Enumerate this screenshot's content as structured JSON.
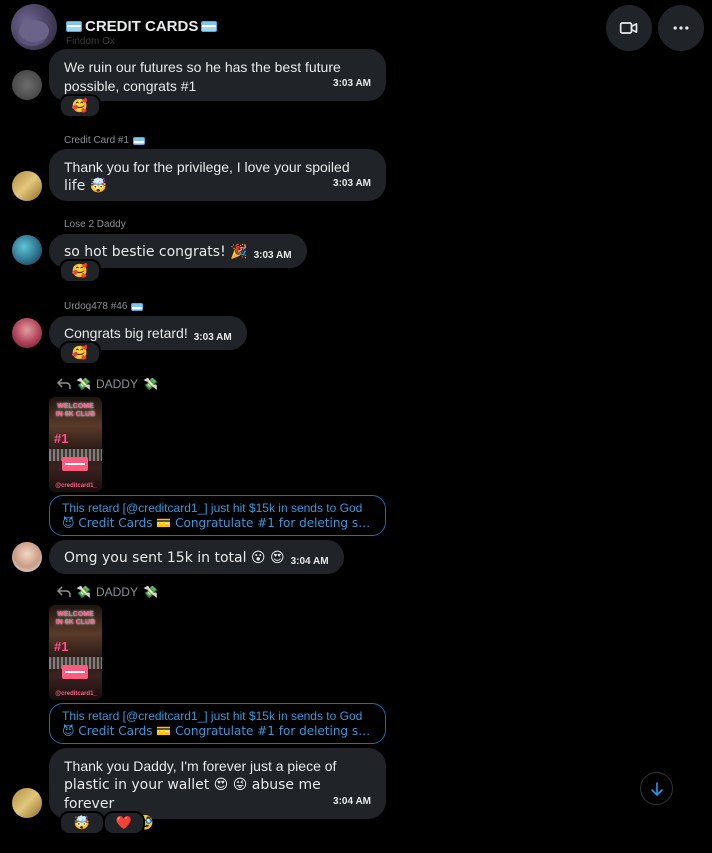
{
  "header": {
    "title": "CREDIT CARDS",
    "cut_off_label": "Findom Ox"
  },
  "messages": [
    {
      "text_lines": [
        "We ruin our futures so he has the best future",
        "possible, congrats #1"
      ],
      "time": "3:03 AM",
      "reaction": "🥰"
    },
    {
      "sender": "Credit Card #1",
      "text_lines": [
        "Thank you for the privilege, I love your spoiled",
        "life 🤯"
      ],
      "time": "3:03 AM"
    },
    {
      "sender": "Lose 2 Daddy",
      "text": "so hot bestie congrats! 🎉",
      "time": "3:03 AM",
      "reaction": "🥰"
    },
    {
      "sender": "Urdog478 #46",
      "text": "Congrats big retard!",
      "time": "3:03 AM",
      "reaction": "🥰"
    }
  ],
  "replies": [
    {
      "reply_to": "DADDY",
      "thumb": {
        "title": "WELCOME IN 6K CLUB",
        "number": "#1",
        "handle": "@creditcard1_"
      },
      "quote_line1": "This retard [@creditcard1_] just hit $15k in sends to God",
      "quote_line2": "😈 Credit Cards 💳 Congratulate #1 for deleting so ...",
      "message": "Omg you sent 15k in total 😮 😍",
      "time": "3:04 AM"
    },
    {
      "reply_to": "DADDY",
      "thumb": {
        "title": "WELCOME IN 6K CLUB",
        "number": "#1",
        "handle": "@creditcard1_"
      },
      "quote_line1": "This retard [@creditcard1_] just hit $15k in sends to God",
      "quote_line2": "😈 Credit Cards 💳 Congratulate #1 for deleting so ...",
      "message_lines": [
        "Thank you Daddy, I'm forever just a piece of",
        "plastic in your wallet 😍 😜 abuse me forever",
        "please 🙏 🥸"
      ],
      "time": "3:04 AM",
      "reactions": [
        "🤯",
        "❤️"
      ]
    }
  ],
  "colors": {
    "background": "#000000",
    "bubble": "#202327",
    "accent": "#1d9bf0",
    "muted": "#8b9095"
  }
}
